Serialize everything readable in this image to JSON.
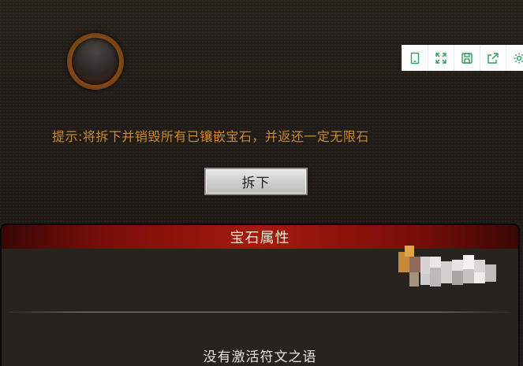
{
  "hint": {
    "text": "提示:将拆下并销毁所有已镶嵌宝石，并返还一定无限石"
  },
  "remove_button": {
    "label": "拆下"
  },
  "properties_panel": {
    "title": "宝石属性",
    "rune_status": "没有激活符文之语"
  },
  "toolbar": {
    "items": [
      {
        "icon": "tablet-icon"
      },
      {
        "icon": "fullscreen-icon"
      },
      {
        "icon": "save-icon"
      },
      {
        "icon": "share-icon"
      },
      {
        "icon": "settings-icon"
      }
    ]
  },
  "colors": {
    "background": "#221c18",
    "hint_text": "#c98a2e",
    "header_red": "#a31a0e",
    "panel": "#272420"
  }
}
